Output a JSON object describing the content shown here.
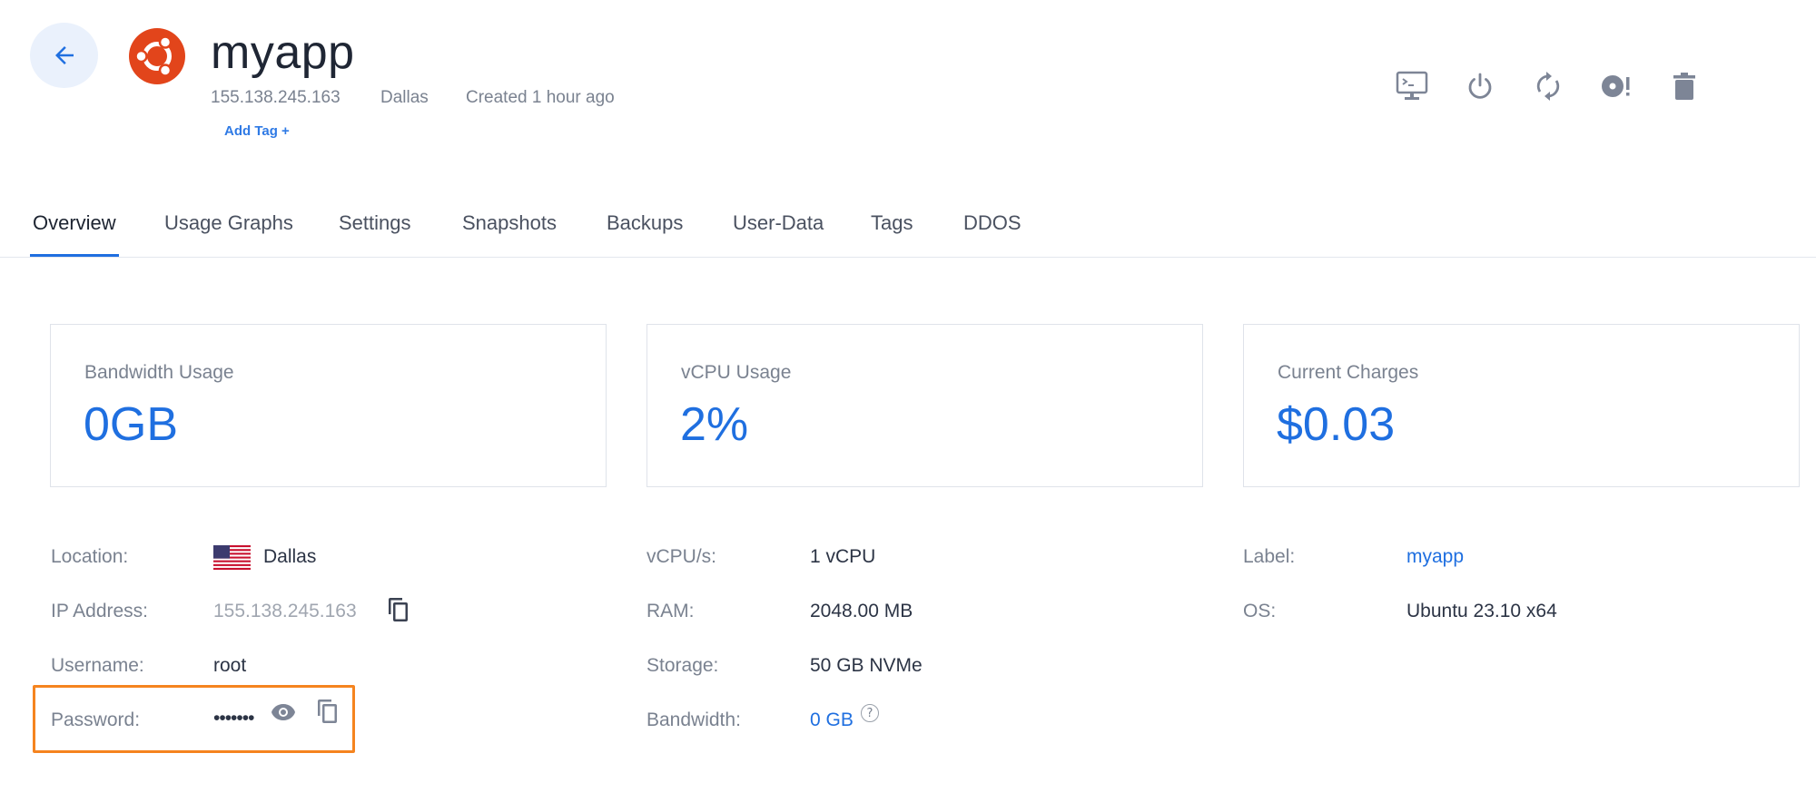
{
  "header": {
    "title": "myapp",
    "ip": "155.138.245.163",
    "location": "Dallas",
    "created": "Created 1 hour ago",
    "add_tag": "Add Tag +",
    "os_icon": "ubuntu-logo",
    "actions": [
      {
        "name": "console-icon"
      },
      {
        "name": "power-icon"
      },
      {
        "name": "restart-icon"
      },
      {
        "name": "reinstall-disc-icon"
      },
      {
        "name": "trash-icon"
      }
    ]
  },
  "tabs": [
    {
      "label": "Overview",
      "active": true
    },
    {
      "label": "Usage Graphs"
    },
    {
      "label": "Settings"
    },
    {
      "label": "Snapshots"
    },
    {
      "label": "Backups"
    },
    {
      "label": "User-Data"
    },
    {
      "label": "Tags"
    },
    {
      "label": "DDOS"
    }
  ],
  "cards": [
    {
      "label": "Bandwidth Usage",
      "value": "0GB"
    },
    {
      "label": "vCPU Usage",
      "value": "2%"
    },
    {
      "label": "Current Charges",
      "value": "$0.03"
    }
  ],
  "details": {
    "col1": {
      "location_label": "Location:",
      "location_value": "Dallas",
      "ip_label": "IP Address:",
      "ip_value": "155.138.245.163",
      "username_label": "Username:",
      "username_value": "root",
      "password_label": "Password:",
      "password_value": "•••••••"
    },
    "col2": {
      "vcpu_label": "vCPU/s:",
      "vcpu_value": "1 vCPU",
      "ram_label": "RAM:",
      "ram_value": "2048.00 MB",
      "storage_label": "Storage:",
      "storage_value": "50 GB NVMe",
      "bandwidth_label": "Bandwidth:",
      "bandwidth_value": "0 GB",
      "bandwidth_help": "?"
    },
    "col3": {
      "label_label": "Label:",
      "label_value": "myapp",
      "os_label": "OS:",
      "os_value": "Ubuntu 23.10 x64"
    }
  },
  "colors": {
    "accent": "#1f6fe0",
    "highlight": "#f5841f",
    "ubuntu": "#e2451b"
  }
}
